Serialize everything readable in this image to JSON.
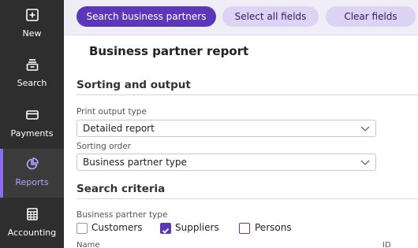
{
  "sidebar": {
    "items": [
      {
        "label": "New",
        "icon": "plus-square-icon"
      },
      {
        "label": "Search",
        "icon": "search-stack-icon"
      },
      {
        "label": "Payments",
        "icon": "credit-card-icon"
      },
      {
        "label": "Reports",
        "icon": "pie-chart-icon",
        "active": true
      },
      {
        "label": "Accounting",
        "icon": "calculator-icon"
      }
    ]
  },
  "toolbar": {
    "search_label": "Search business partners",
    "select_all_label": "Select all fields",
    "clear_label": "Clear fields"
  },
  "page": {
    "title": "Business partner report"
  },
  "sorting": {
    "heading": "Sorting and output",
    "print_output_label": "Print output type",
    "print_output_value": "Detailed report",
    "sorting_order_label": "Sorting order",
    "sorting_order_value": "Business partner type"
  },
  "criteria": {
    "heading": "Search criteria",
    "bp_type_label": "Business partner type",
    "options": [
      {
        "label": "Customers",
        "checked": false
      },
      {
        "label": "Suppliers",
        "checked": true
      },
      {
        "label": "Persons",
        "checked": false
      }
    ],
    "columns": {
      "name": "Name",
      "id": "ID"
    }
  },
  "colors": {
    "accent": "#5b38b8",
    "sidebar_bg": "#2e2e2e",
    "active_label": "#b7a4ff",
    "secondary_button": "#dcd3f5"
  }
}
